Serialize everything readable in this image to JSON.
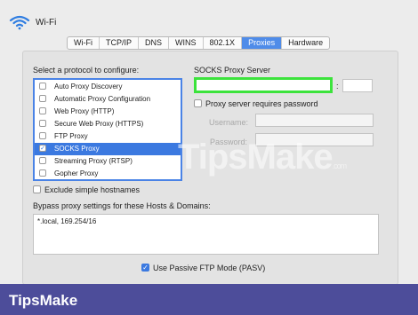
{
  "window": {
    "title": "Wi-Fi"
  },
  "tabs": [
    {
      "label": "Wi-Fi",
      "active": false
    },
    {
      "label": "TCP/IP",
      "active": false
    },
    {
      "label": "DNS",
      "active": false
    },
    {
      "label": "WINS",
      "active": false
    },
    {
      "label": "802.1X",
      "active": false
    },
    {
      "label": "Proxies",
      "active": true
    },
    {
      "label": "Hardware",
      "active": false
    }
  ],
  "protocols": {
    "heading": "Select a protocol to configure:",
    "items": [
      {
        "label": "Auto Proxy Discovery",
        "checked": false,
        "selected": false
      },
      {
        "label": "Automatic Proxy Configuration",
        "checked": false,
        "selected": false
      },
      {
        "label": "Web Proxy (HTTP)",
        "checked": false,
        "selected": false
      },
      {
        "label": "Secure Web Proxy (HTTPS)",
        "checked": false,
        "selected": false
      },
      {
        "label": "FTP Proxy",
        "checked": false,
        "selected": false
      },
      {
        "label": "SOCKS Proxy",
        "checked": true,
        "selected": true
      },
      {
        "label": "Streaming Proxy (RTSP)",
        "checked": false,
        "selected": false
      },
      {
        "label": "Gopher Proxy",
        "checked": false,
        "selected": false
      }
    ]
  },
  "socks": {
    "heading": "SOCKS Proxy Server",
    "server_value": "",
    "port_value": "",
    "colon": ":",
    "requires_password_label": "Proxy server requires password",
    "requires_password": false,
    "username_label": "Username:",
    "password_label": "Password:"
  },
  "exclude_simple_label": "Exclude simple hostnames",
  "bypass": {
    "label": "Bypass proxy settings for these Hosts & Domains:",
    "value": "*.local, 169.254/16"
  },
  "passive_ftp": {
    "label": "Use Passive FTP Mode (PASV)",
    "checked": true
  },
  "watermark": {
    "main": "TipsMake",
    "suffix": ".com"
  },
  "footer": {
    "brand": "TipsMake"
  },
  "colors": {
    "accent": "#3b79e0",
    "highlight_border": "#3ce33c",
    "footer_bg": "#4d4d9a"
  }
}
